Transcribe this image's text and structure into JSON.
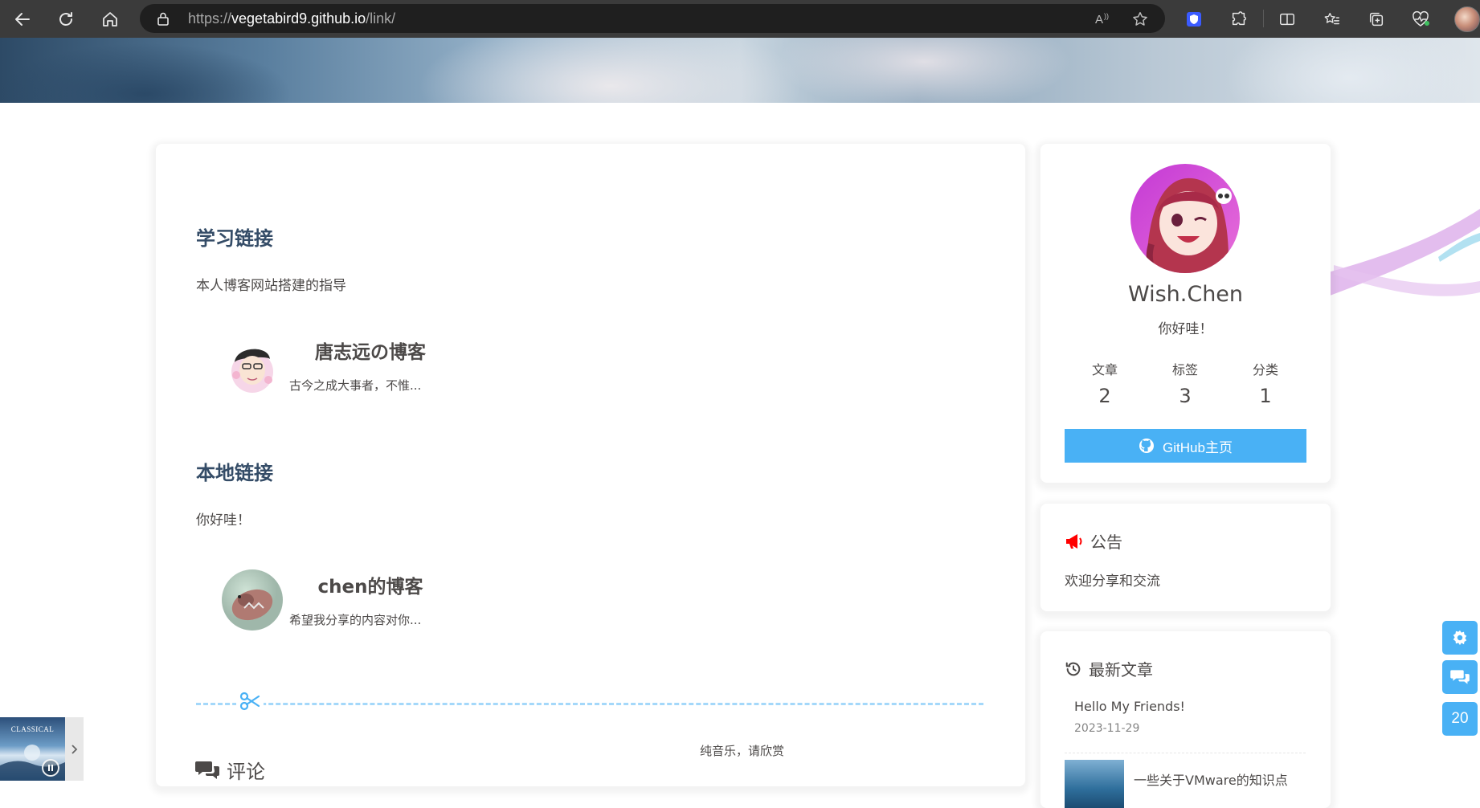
{
  "browser": {
    "url_scheme": "https://",
    "url_host": "vegetabird9.github.io",
    "url_path": "/link/"
  },
  "content": {
    "sections": [
      {
        "heading": "学习链接",
        "description": "本人博客网站搭建的指导",
        "link": {
          "name": "唐志远の博客",
          "desc": "古今之成大事者，不惟..."
        }
      },
      {
        "heading": "本地链接",
        "description": "你好哇！",
        "link": {
          "name": "chen的博客",
          "desc": "希望我分享的内容对你..."
        }
      }
    ],
    "comment_label": "评论",
    "music_note": "纯音乐，请欣赏"
  },
  "author": {
    "name": "Wish.Chen",
    "description": "你好哇！",
    "stats": [
      {
        "label": "文章",
        "value": "2"
      },
      {
        "label": "标签",
        "value": "3"
      },
      {
        "label": "分类",
        "value": "1"
      }
    ],
    "github_button": "GitHub主页"
  },
  "announcement": {
    "title": "公告",
    "text": "欢迎分享和交流"
  },
  "recent_posts": {
    "title": "最新文章",
    "items": [
      {
        "title": "Hello My Friends!",
        "date": "2023-11-29"
      },
      {
        "title": "一些关于VMware的知识点",
        "date": ""
      }
    ]
  },
  "right_side": {
    "counter": "20"
  },
  "player": {
    "cover_text": "CLASSICAL"
  },
  "colors": {
    "accent": "#49b1f5",
    "heading": "#344c67",
    "text": "#4c4948",
    "announce_icon": "#ff0000"
  }
}
